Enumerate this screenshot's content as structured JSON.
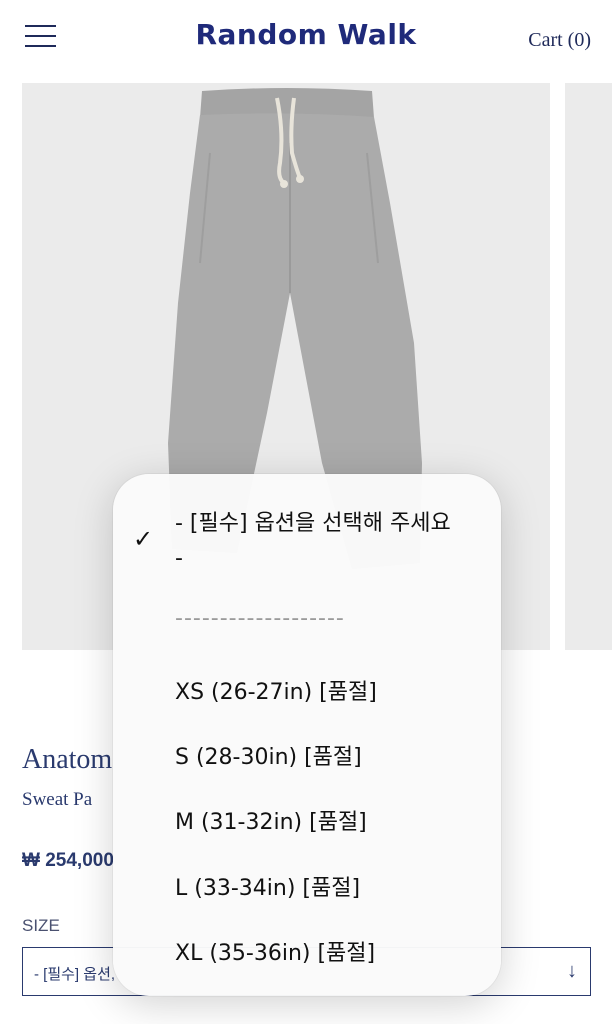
{
  "header": {
    "brand": "Random Walk",
    "cart_label": "Cart (0)"
  },
  "product": {
    "title": "Anatom",
    "subtitle": "Sweat Pa",
    "price": "₩ 254,000",
    "size_label": "SIZE",
    "select_value": "- [필수] 옵션,"
  },
  "picker": {
    "options": [
      {
        "label": "- [필수] 옵션을 선택해 주세요 -",
        "selected": true
      },
      {
        "label": "-------------------"
      },
      {
        "label": "XS (26-27in) [품절]"
      },
      {
        "label": "S (28-30in) [품절]"
      },
      {
        "label": "M (31-32in) [품절]"
      },
      {
        "label": "L (33-34in) [품절]"
      },
      {
        "label": "XL (35-36in) [품절]"
      }
    ]
  },
  "icons": {
    "menu": "hamburger-icon",
    "check": "checkmark-icon",
    "select_arrow": "arrow-down-icon"
  },
  "colors": {
    "brand": "#1f2a7a",
    "text": "#2a3a6e",
    "image_bg": "#ebebeb",
    "pants": "#a9a9a9"
  }
}
